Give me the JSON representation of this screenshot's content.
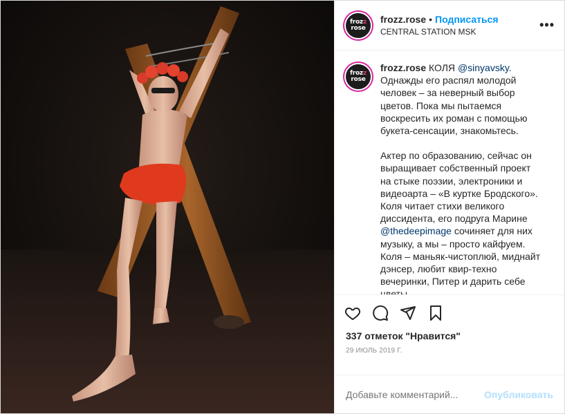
{
  "post": {
    "username": "frozz.rose",
    "dot": "•",
    "follow_label": "Подписаться",
    "location": "CENTRAL STATION MSK",
    "more_label": "•••",
    "avatar_logo_top": "froz",
    "avatar_logo_z": "z",
    "avatar_logo_bottom": "rose"
  },
  "caption": {
    "username": "frozz.rose",
    "intro": " КОЛЯ ",
    "mention1": "@sinyavsky",
    "intro_after": ". Однажды его распял молодой человек – за неверный выбор цветов. Пока мы пытаемся воскресить их роман с помощью букета-сенсации, знакомьтесь.",
    "p2_before": "Актер по образованию, сейчас он выращивает собственный проект на стыке поэзии, электроники и видеоарта – «В куртке Бродского». Коля читает стихи великого диссидента, его подруга Марине ",
    "mention2": "@thedeepimage",
    "p2_after": " сочиняет для них музыку, а мы – просто кайфуем.",
    "p3": "Коля – маньяк-чистоплюй, миднайт дэнсер, любит квир-техно вечеринки, Питер и дарить себе цветы.",
    "box_glyph": ""
  },
  "actions": {
    "like_icon": "heart-icon",
    "comment_icon": "comment-icon",
    "share_icon": "share-icon",
    "save_icon": "bookmark-icon"
  },
  "likes": "337 отметок \"Нравится\"",
  "date": "29 ИЮЛЬ 2019 Г.",
  "comment": {
    "placeholder": "Добавьте комментарий...",
    "publish_label": "Опубликовать"
  },
  "colors": {
    "follow": "#0095f6",
    "publish_disabled": "#b2dffc",
    "mention": "#00376b",
    "avatar_ring": "#d6249f"
  }
}
